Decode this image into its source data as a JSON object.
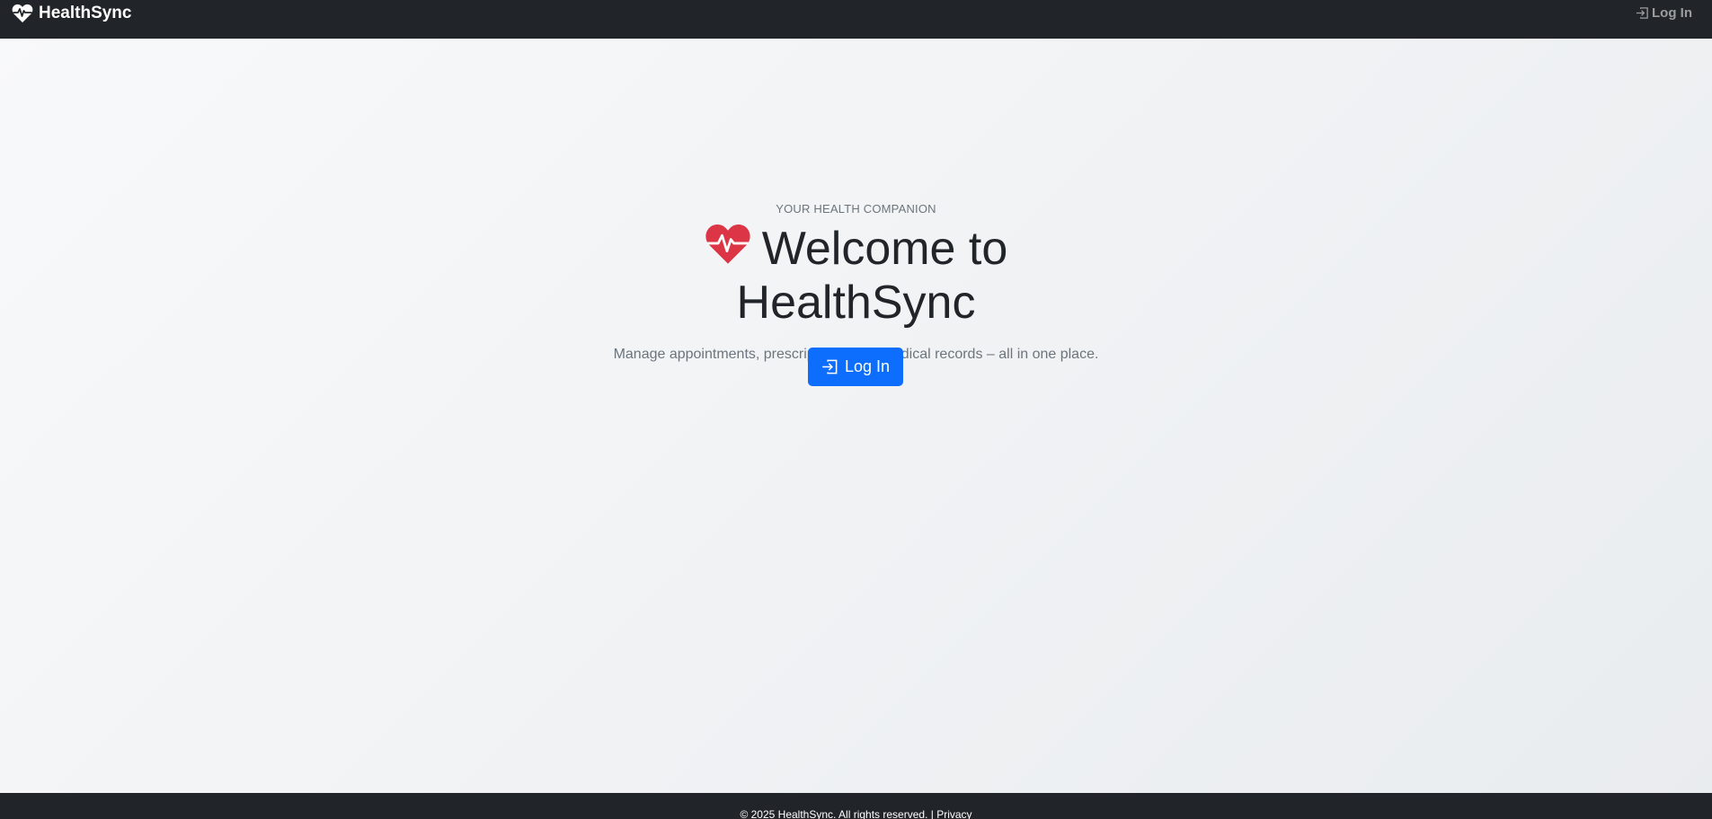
{
  "navbar": {
    "brand_name": "HealthSync",
    "brand_icon": "heart-pulse-icon",
    "login_label": "Log In",
    "login_icon": "box-arrow-in-right-icon",
    "background_color": "#212529"
  },
  "hero": {
    "eyebrow": "YOUR HEALTH COMPANION",
    "title_line1": "Welcome to",
    "title_line2": "HealthSync",
    "title_icon": "heart-pulse-icon",
    "title_icon_color": "#dc3545",
    "lead": "Manage appointments, prescriptions, and medical records – all in one place.",
    "cta_label": "Log In",
    "cta_icon": "box-arrow-in-right-icon",
    "cta_color": "#0d6efd"
  },
  "footer": {
    "copyright": "© 2025 HealthSync. All rights reserved. |",
    "privacy_label": "Privacy"
  }
}
